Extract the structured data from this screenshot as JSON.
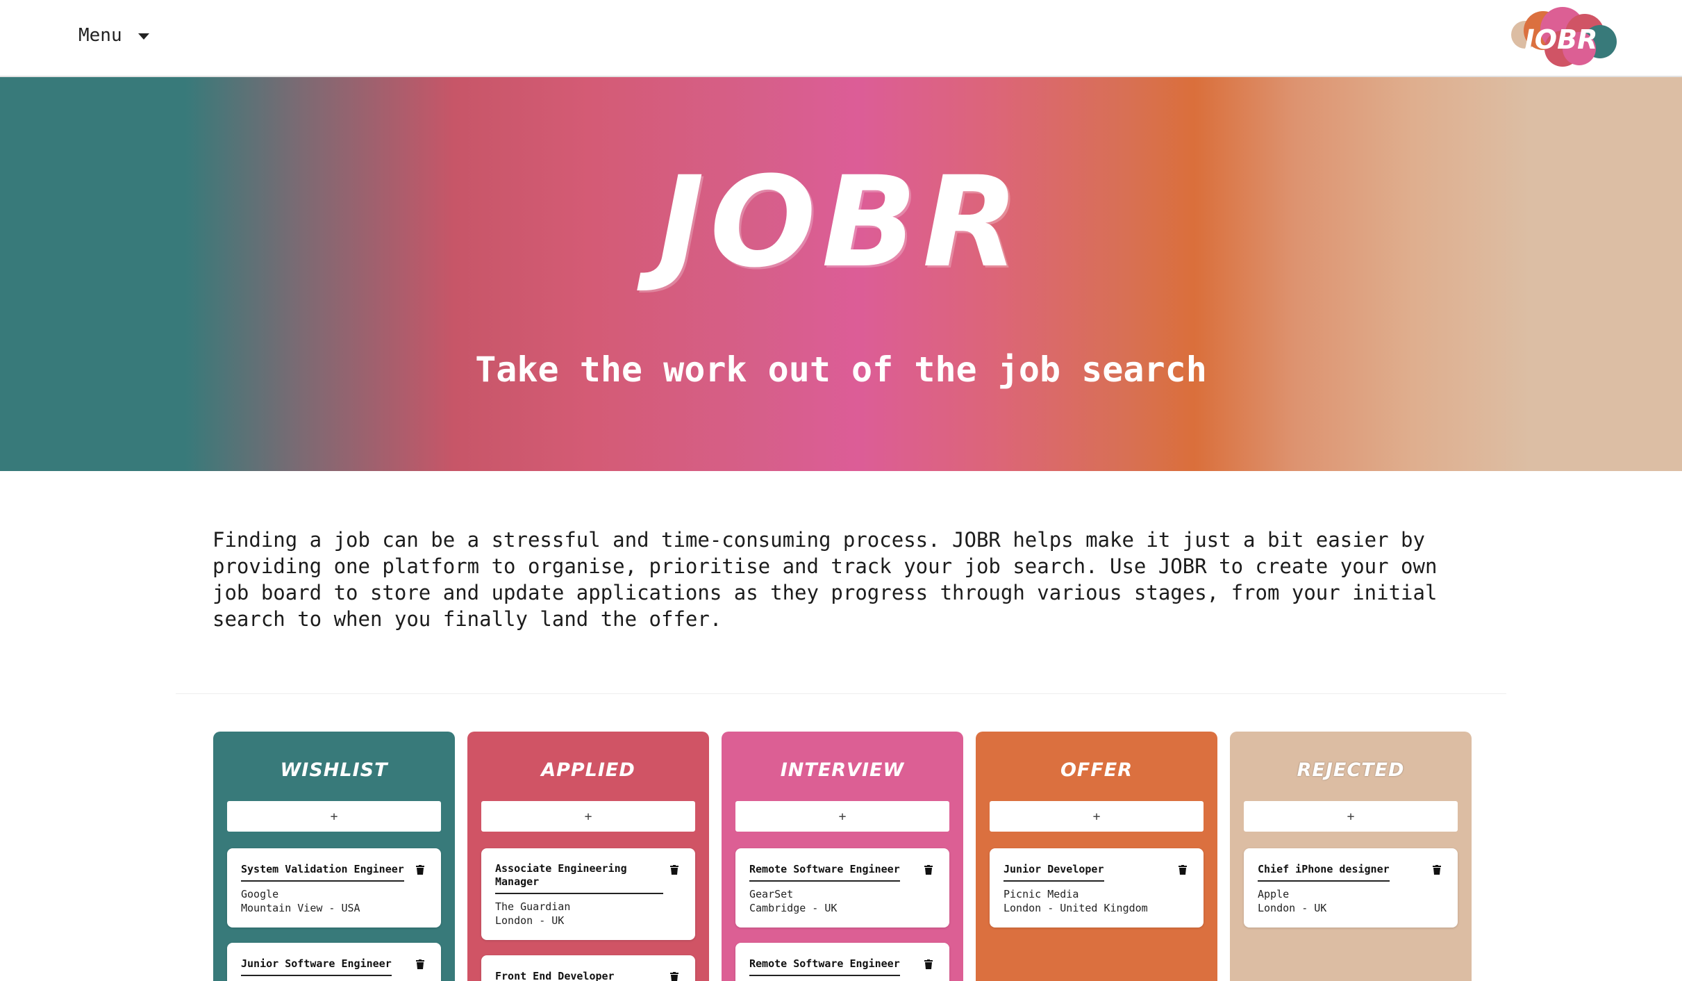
{
  "nav": {
    "menu_label": "Menu",
    "logo_text": "JOBR"
  },
  "hero": {
    "title": "JOBR",
    "subtitle": "Take the work out of the job search"
  },
  "intro": {
    "text": "Finding a job can be a stressful and time-consuming process. JOBR helps make it just a bit easier by providing one platform to organise, prioritise and track your job search. Use JOBR to create your own job board to store and update applications as they progress through various stages, from your initial search to when you finally land the offer."
  },
  "colors": {
    "teal": "#387a7a",
    "red": "#d05465",
    "pink": "#dc5f94",
    "orange": "#db703f",
    "beige": "#dcbda3"
  },
  "columns": [
    {
      "title": "WISHLIST",
      "color": "#387a7a",
      "add_label": "+",
      "cards": [
        {
          "title": "System Validation Engineer",
          "company": "Google",
          "location": "Mountain View - USA"
        },
        {
          "title": "Junior Software Engineer",
          "company": "",
          "location": ""
        }
      ]
    },
    {
      "title": "APPLIED",
      "color": "#d05465",
      "add_label": "+",
      "cards": [
        {
          "title": "Associate Engineering Manager",
          "company": "The Guardian",
          "location": "London - UK"
        },
        {
          "title": "Front End Developer",
          "company": "",
          "location": ""
        }
      ]
    },
    {
      "title": "INTERVIEW",
      "color": "#dc5f94",
      "add_label": "+",
      "cards": [
        {
          "title": "Remote Software Engineer",
          "company": "GearSet",
          "location": "Cambridge - UK"
        },
        {
          "title": "Remote Software Engineer",
          "company": "",
          "location": ""
        }
      ]
    },
    {
      "title": "OFFER",
      "color": "#db703f",
      "add_label": "+",
      "cards": [
        {
          "title": "Junior Developer",
          "company": "Picnic Media",
          "location": "London - United Kingdom"
        }
      ]
    },
    {
      "title": "REJECTED",
      "color": "#dcbda3",
      "add_label": "+",
      "cards": [
        {
          "title": "Chief iPhone designer",
          "company": "Apple",
          "location": "London - UK"
        }
      ]
    }
  ]
}
